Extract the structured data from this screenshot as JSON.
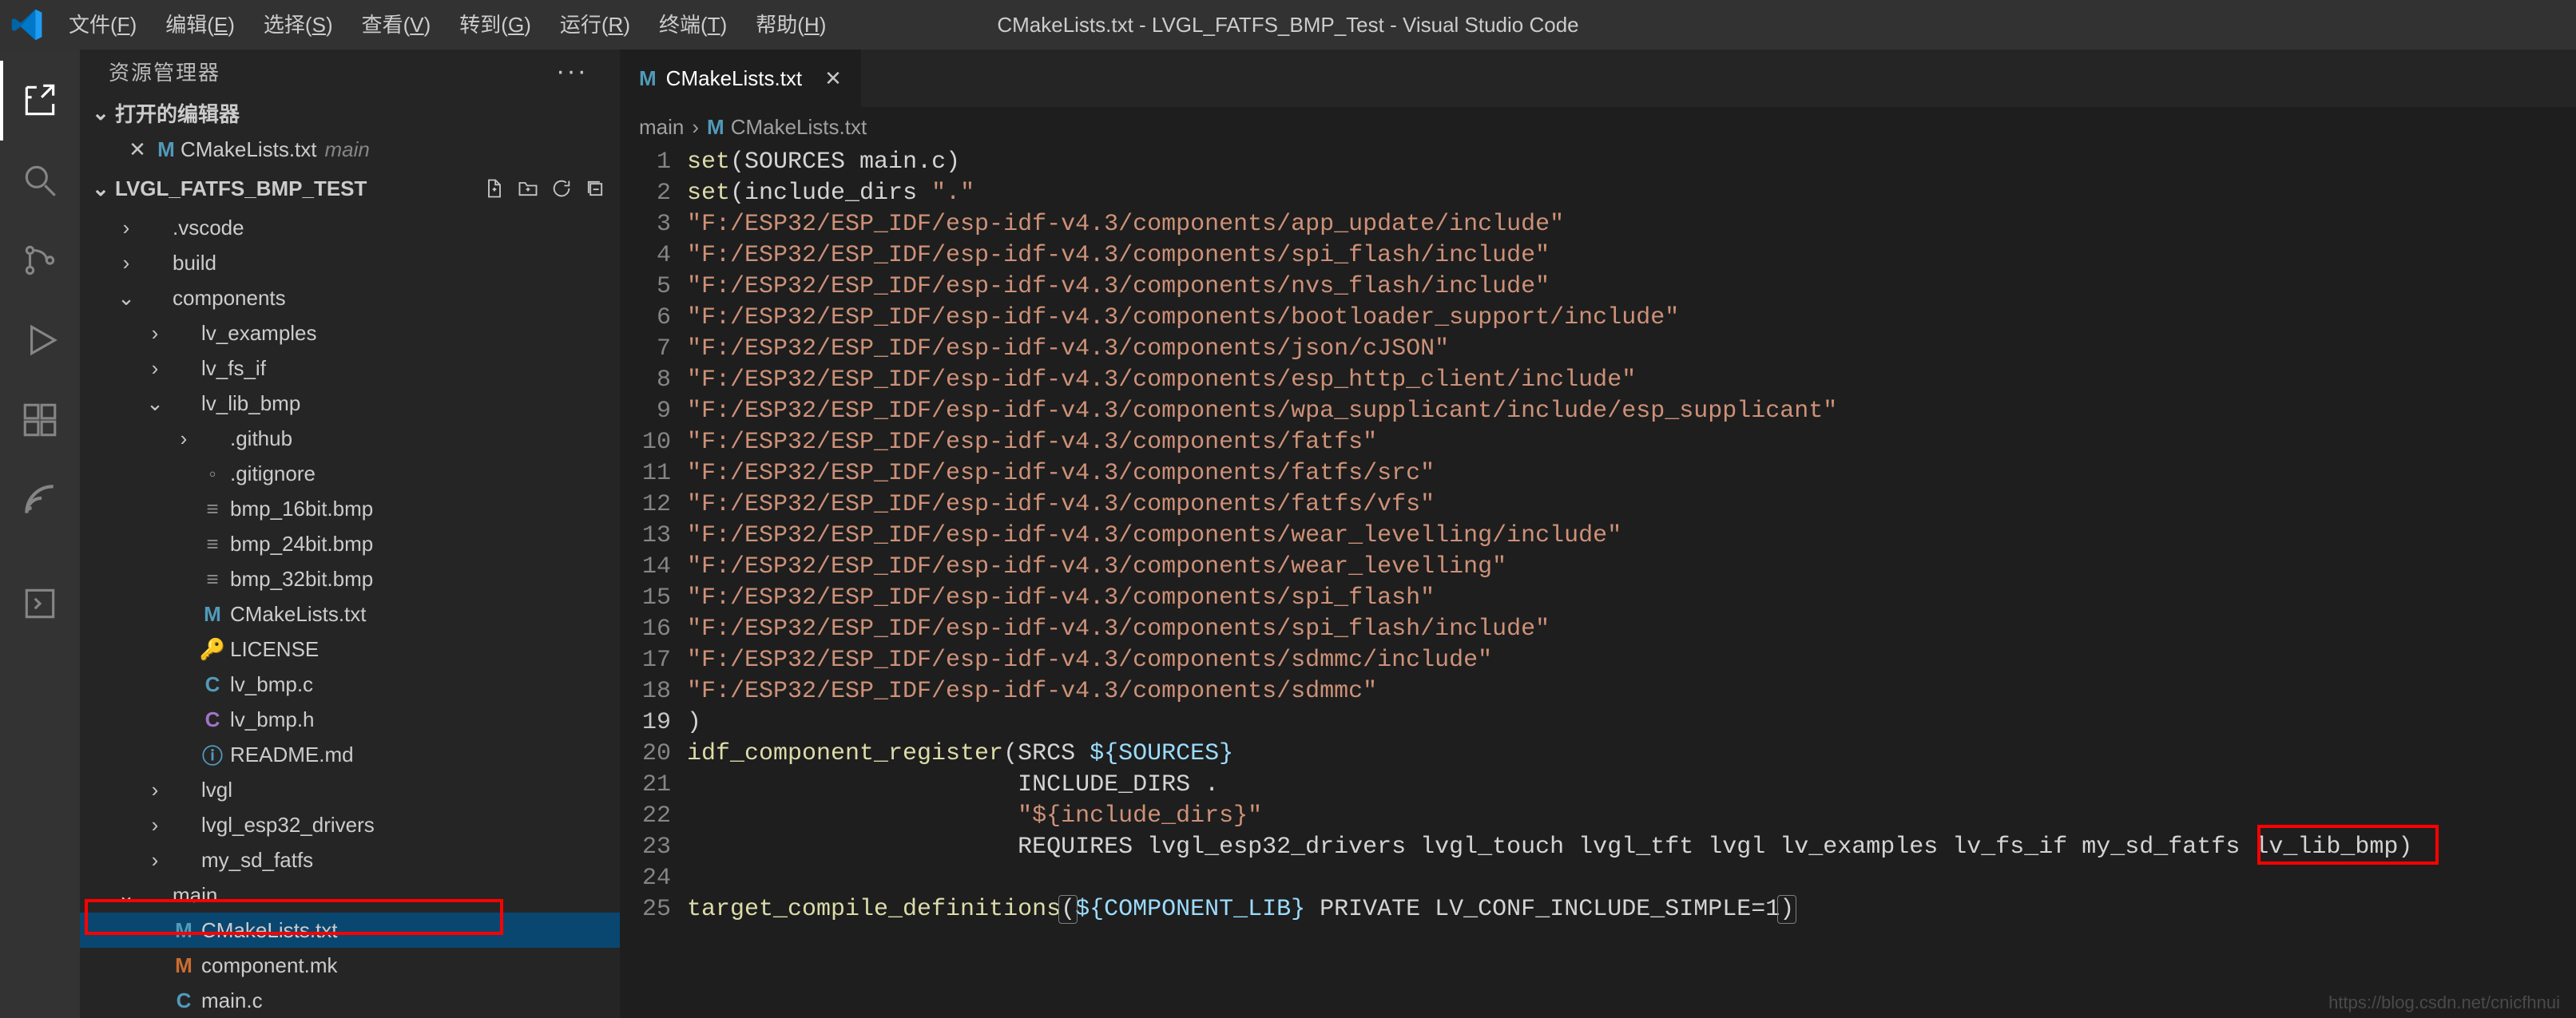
{
  "titlebar": {
    "title": "CMakeLists.txt - LVGL_FATFS_BMP_Test - Visual Studio Code",
    "menu": [
      {
        "label": "文件",
        "mnemonic": "F"
      },
      {
        "label": "编辑",
        "mnemonic": "E"
      },
      {
        "label": "选择",
        "mnemonic": "S"
      },
      {
        "label": "查看",
        "mnemonic": "V"
      },
      {
        "label": "转到",
        "mnemonic": "G"
      },
      {
        "label": "运行",
        "mnemonic": "R"
      },
      {
        "label": "终端",
        "mnemonic": "T"
      },
      {
        "label": "帮助",
        "mnemonic": "H"
      }
    ]
  },
  "sidebar": {
    "title": "资源管理器",
    "openEditors": {
      "header": "打开的编辑器",
      "items": [
        {
          "icon": "M",
          "iconColor": "icon-blue",
          "name": "CMakeLists.txt",
          "desc": "main"
        }
      ]
    },
    "project": {
      "header": "LVGL_FATFS_BMP_TEST"
    },
    "tree": [
      {
        "depth": 0,
        "twisty": ">",
        "icon": "",
        "iconColor": "",
        "label": ".vscode",
        "sel": false
      },
      {
        "depth": 0,
        "twisty": ">",
        "icon": "",
        "iconColor": "",
        "label": "build",
        "sel": false
      },
      {
        "depth": 0,
        "twisty": "v",
        "icon": "",
        "iconColor": "",
        "label": "components",
        "sel": false
      },
      {
        "depth": 1,
        "twisty": ">",
        "icon": "",
        "iconColor": "",
        "label": "lv_examples",
        "sel": false
      },
      {
        "depth": 1,
        "twisty": ">",
        "icon": "",
        "iconColor": "",
        "label": "lv_fs_if",
        "sel": false
      },
      {
        "depth": 1,
        "twisty": "v",
        "icon": "",
        "iconColor": "",
        "label": "lv_lib_bmp",
        "sel": false
      },
      {
        "depth": 2,
        "twisty": ">",
        "icon": "",
        "iconColor": "",
        "label": ".github",
        "sel": false
      },
      {
        "depth": 2,
        "twisty": "",
        "icon": "◦",
        "iconColor": "icon-gray",
        "label": ".gitignore",
        "sel": false
      },
      {
        "depth": 2,
        "twisty": "",
        "icon": "≡",
        "iconColor": "icon-gray",
        "label": "bmp_16bit.bmp",
        "sel": false
      },
      {
        "depth": 2,
        "twisty": "",
        "icon": "≡",
        "iconColor": "icon-gray",
        "label": "bmp_24bit.bmp",
        "sel": false
      },
      {
        "depth": 2,
        "twisty": "",
        "icon": "≡",
        "iconColor": "icon-gray",
        "label": "bmp_32bit.bmp",
        "sel": false
      },
      {
        "depth": 2,
        "twisty": "",
        "icon": "M",
        "iconColor": "icon-blue",
        "label": "CMakeLists.txt",
        "sel": false
      },
      {
        "depth": 2,
        "twisty": "",
        "icon": "🔑",
        "iconColor": "icon-yellow",
        "label": "LICENSE",
        "sel": false
      },
      {
        "depth": 2,
        "twisty": "",
        "icon": "C",
        "iconColor": "icon-blue",
        "label": "lv_bmp.c",
        "sel": false
      },
      {
        "depth": 2,
        "twisty": "",
        "icon": "C",
        "iconColor": "icon-purple",
        "label": "lv_bmp.h",
        "sel": false
      },
      {
        "depth": 2,
        "twisty": "",
        "icon": "ⓘ",
        "iconColor": "icon-info",
        "label": "README.md",
        "sel": false
      },
      {
        "depth": 1,
        "twisty": ">",
        "icon": "",
        "iconColor": "",
        "label": "lvgl",
        "sel": false
      },
      {
        "depth": 1,
        "twisty": ">",
        "icon": "",
        "iconColor": "",
        "label": "lvgl_esp32_drivers",
        "sel": false
      },
      {
        "depth": 1,
        "twisty": ">",
        "icon": "",
        "iconColor": "",
        "label": "my_sd_fatfs",
        "sel": false
      },
      {
        "depth": 0,
        "twisty": "v",
        "icon": "",
        "iconColor": "",
        "label": "main",
        "sel": false
      },
      {
        "depth": 1,
        "twisty": "",
        "icon": "M",
        "iconColor": "icon-blue",
        "label": "CMakeLists.txt",
        "sel": true
      },
      {
        "depth": 1,
        "twisty": "",
        "icon": "M",
        "iconColor": "icon-orange",
        "label": "component.mk",
        "sel": false
      },
      {
        "depth": 1,
        "twisty": "",
        "icon": "C",
        "iconColor": "icon-blue",
        "label": "main.c",
        "sel": false
      }
    ]
  },
  "tab": {
    "icon": "M",
    "label": "CMakeLists.txt"
  },
  "breadcrumbs": {
    "seg1": "main",
    "icon": "M",
    "seg2": "CMakeLists.txt"
  },
  "code": {
    "lines": [
      [
        {
          "c": "tk-fn",
          "t": "set"
        },
        {
          "c": "tk-op",
          "t": "("
        },
        {
          "c": "tk-ident",
          "t": "SOURCES main.c"
        },
        {
          "c": "tk-op",
          "t": ")"
        }
      ],
      [
        {
          "c": "tk-fn",
          "t": "set"
        },
        {
          "c": "tk-op",
          "t": "("
        },
        {
          "c": "tk-ident",
          "t": "include_dirs "
        },
        {
          "c": "tk-str",
          "t": "\".\""
        }
      ],
      [
        {
          "c": "tk-str",
          "t": "\"F:/ESP32/ESP_IDF/esp-idf-v4.3/components/app_update/include\""
        }
      ],
      [
        {
          "c": "tk-str",
          "t": "\"F:/ESP32/ESP_IDF/esp-idf-v4.3/components/spi_flash/include\""
        }
      ],
      [
        {
          "c": "tk-str",
          "t": "\"F:/ESP32/ESP_IDF/esp-idf-v4.3/components/nvs_flash/include\""
        }
      ],
      [
        {
          "c": "tk-str",
          "t": "\"F:/ESP32/ESP_IDF/esp-idf-v4.3/components/bootloader_support/include\""
        }
      ],
      [
        {
          "c": "tk-str",
          "t": "\"F:/ESP32/ESP_IDF/esp-idf-v4.3/components/json/cJSON\""
        }
      ],
      [
        {
          "c": "tk-str",
          "t": "\"F:/ESP32/ESP_IDF/esp-idf-v4.3/components/esp_http_client/include\""
        }
      ],
      [
        {
          "c": "tk-str",
          "t": "\"F:/ESP32/ESP_IDF/esp-idf-v4.3/components/wpa_supplicant/include/esp_supplicant\""
        }
      ],
      [
        {
          "c": "tk-str",
          "t": "\"F:/ESP32/ESP_IDF/esp-idf-v4.3/components/fatfs\""
        }
      ],
      [
        {
          "c": "tk-str",
          "t": "\"F:/ESP32/ESP_IDF/esp-idf-v4.3/components/fatfs/src\""
        }
      ],
      [
        {
          "c": "tk-str",
          "t": "\"F:/ESP32/ESP_IDF/esp-idf-v4.3/components/fatfs/vfs\""
        }
      ],
      [
        {
          "c": "tk-str",
          "t": "\"F:/ESP32/ESP_IDF/esp-idf-v4.3/components/wear_levelling/include\""
        }
      ],
      [
        {
          "c": "tk-str",
          "t": "\"F:/ESP32/ESP_IDF/esp-idf-v4.3/components/wear_levelling\""
        }
      ],
      [
        {
          "c": "tk-str",
          "t": "\"F:/ESP32/ESP_IDF/esp-idf-v4.3/components/spi_flash\""
        }
      ],
      [
        {
          "c": "tk-str",
          "t": "\"F:/ESP32/ESP_IDF/esp-idf-v4.3/components/spi_flash/include\""
        }
      ],
      [
        {
          "c": "tk-str",
          "t": "\"F:/ESP32/ESP_IDF/esp-idf-v4.3/components/sdmmc/include\""
        }
      ],
      [
        {
          "c": "tk-str",
          "t": "\"F:/ESP32/ESP_IDF/esp-idf-v4.3/components/sdmmc\""
        }
      ],
      [
        {
          "c": "tk-op",
          "t": ")"
        }
      ],
      [
        {
          "c": "tk-fn",
          "t": "idf_component_register"
        },
        {
          "c": "tk-op",
          "t": "("
        },
        {
          "c": "tk-ident",
          "t": "SRCS "
        },
        {
          "c": "tk-var",
          "t": "${SOURCES}"
        }
      ],
      [
        {
          "c": "tk-txt",
          "t": "                       INCLUDE_DIRS ."
        }
      ],
      [
        {
          "c": "tk-txt",
          "t": "                       "
        },
        {
          "c": "tk-str",
          "t": "\"${include_dirs}\""
        }
      ],
      [
        {
          "c": "tk-txt",
          "t": "                       REQUIRES lvgl_esp32_drivers lvgl_touch lvgl_tft lvgl lv_examples lv_fs_if my_sd_fatfs lv_lib_bmp"
        },
        {
          "c": "tk-op",
          "t": ")"
        }
      ],
      [],
      [
        {
          "c": "tk-fn",
          "t": "target_compile_definitions"
        },
        {
          "c": "tk-op hl-box",
          "t": "("
        },
        {
          "c": "tk-var",
          "t": "${COMPONENT_LIB}"
        },
        {
          "c": "tk-txt",
          "t": " PRIVATE LV_CONF_INCLUDE_SIMPLE=1"
        },
        {
          "c": "tk-op hl-box",
          "t": ")"
        }
      ]
    ],
    "currentLine": 19
  },
  "watermark": "https://blog.csdn.net/cnicfhnui"
}
